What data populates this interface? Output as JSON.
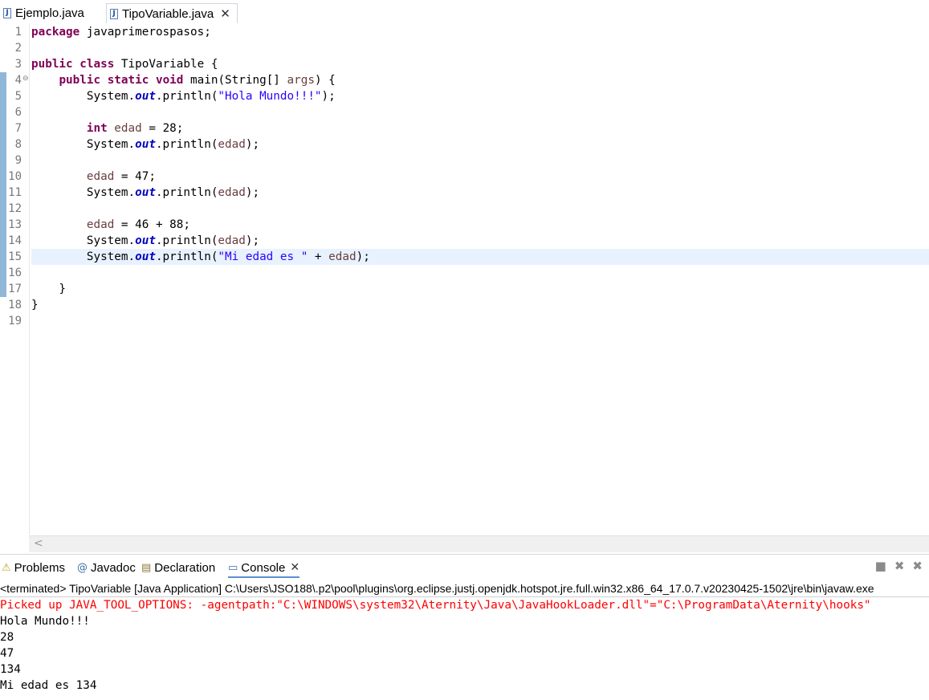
{
  "editor_tabs": [
    {
      "label": "Ejemplo.java",
      "icon": "java-file-icon",
      "active": false
    },
    {
      "label": "TipoVariable.java",
      "icon": "java-file-icon",
      "active": true,
      "close_glyph": "✕"
    }
  ],
  "line_numbers": [
    "1",
    "2",
    "3",
    "4",
    "5",
    "6",
    "7",
    "8",
    "9",
    "10",
    "11",
    "12",
    "13",
    "14",
    "15",
    "16",
    "17",
    "18",
    "19"
  ],
  "code": {
    "l1": {
      "kw": "package",
      "rest": " javaprimerospasos;"
    },
    "l3": {
      "kw1": "public",
      "kw2": "class",
      "rest": " TipoVariable {"
    },
    "l4": {
      "indent": "    ",
      "kw1": "public",
      "kw2": "static",
      "kw3": "void",
      "a": " main(String[] ",
      "var": "args",
      "b": ") {"
    },
    "l5": {
      "a": "        System.",
      "fld": "out",
      "b": ".println(",
      "str": "\"Hola Mundo!!!\"",
      "c": ");"
    },
    "l7": {
      "a": "        ",
      "kw": "int",
      "var": " edad",
      "b": " = 28;"
    },
    "l8": {
      "a": "        System.",
      "fld": "out",
      "b": ".println(",
      "var": "edad",
      "c": ");"
    },
    "l10": {
      "a": "        ",
      "var": "edad",
      "b": " = 47;"
    },
    "l11": {
      "a": "        System.",
      "fld": "out",
      "b": ".println(",
      "var": "edad",
      "c": ");"
    },
    "l13": {
      "a": "        ",
      "var": "edad",
      "b": " = 46 + 88;"
    },
    "l14": {
      "a": "        System.",
      "fld": "out",
      "b": ".println(",
      "var": "edad",
      "c": ");"
    },
    "l15": {
      "a": "        System.",
      "fld": "out",
      "b": ".println(",
      "str": "\"Mi edad es \"",
      "c": " + ",
      "var": "edad",
      "d": ");"
    },
    "l17": {
      "text": "    }"
    },
    "l18": {
      "text": "}"
    }
  },
  "panel_tabs": [
    {
      "label": "Problems",
      "icon": "problems-icon",
      "glyph": "⚠"
    },
    {
      "label": "Javadoc",
      "icon": "javadoc-icon",
      "glyph": "@"
    },
    {
      "label": "Declaration",
      "icon": "declaration-icon",
      "glyph": "▤"
    },
    {
      "label": "Console",
      "icon": "console-icon",
      "glyph": "▭",
      "active": true,
      "close_glyph": "✕"
    }
  ],
  "panel_tools": {
    "stop_glyph": "■",
    "remove_glyph": "✖",
    "remove_all_glyph": "✖"
  },
  "console": {
    "terminated": "<terminated> TipoVariable [Java Application] C:\\Users\\JSO188\\.p2\\pool\\plugins\\org.eclipse.justj.openjdk.hotspot.jre.full.win32.x86_64_17.0.7.v20230425-1502\\jre\\bin\\javaw.exe",
    "lines": [
      "Picked up JAVA_TOOL_OPTIONS: -agentpath:\"C:\\WINDOWS\\system32\\Aternity\\Java\\JavaHookLoader.dll\"=\"C:\\ProgramData\\Aternity\\hooks\"",
      "Hola Mundo!!!",
      "28",
      "47",
      "134",
      "Mi edad es 134"
    ]
  },
  "colors": {
    "keyword": "#7f0055",
    "string": "#2a00ff",
    "field": "#0000c0",
    "variable": "#6a3e3e",
    "error": "#ff0000",
    "current_line": "#e8f2fe"
  }
}
